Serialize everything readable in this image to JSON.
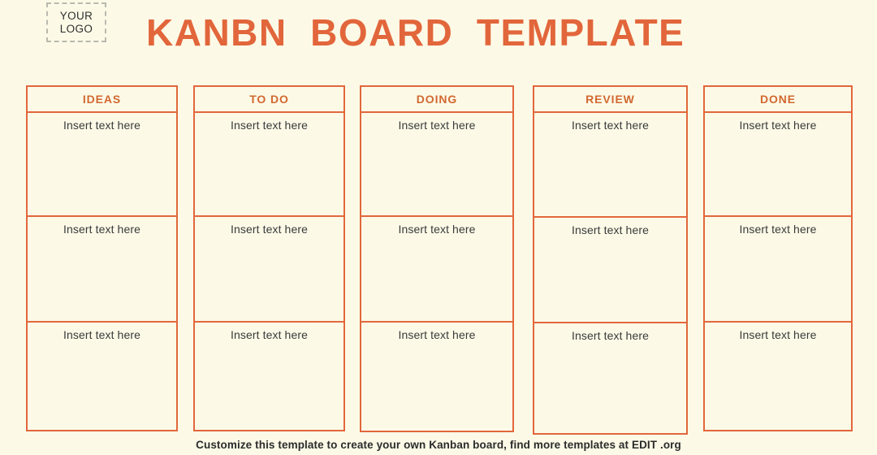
{
  "page": {
    "background_color": "#fcfae7",
    "accent_color": "#e2673c",
    "header_text_color": "#d2682f",
    "body_text_color": "#3a3a3a"
  },
  "logo": {
    "line1": "YOUR",
    "line2": "LOGO"
  },
  "title": "KANBN  BOARD  TEMPLATE",
  "board": {
    "card_placeholder": "Insert text here",
    "columns": [
      {
        "header": "IDEAS",
        "cards": [
          "Insert text here",
          "Insert text here",
          "Insert text here"
        ]
      },
      {
        "header": "TO DO",
        "cards": [
          "Insert text here",
          "Insert text here",
          "Insert text here"
        ]
      },
      {
        "header": "DOING",
        "cards": [
          "Insert text here",
          "Insert text here",
          "Insert text here"
        ]
      },
      {
        "header": "REVIEW",
        "cards": [
          "Insert text here",
          "Insert text here",
          "Insert text here"
        ]
      },
      {
        "header": "DONE",
        "cards": [
          "Insert text here",
          "Insert text here",
          "Insert text here"
        ]
      }
    ]
  },
  "footer": {
    "note": "Customize this template to create your own Kanban board, find more templates at EDIT .org"
  }
}
